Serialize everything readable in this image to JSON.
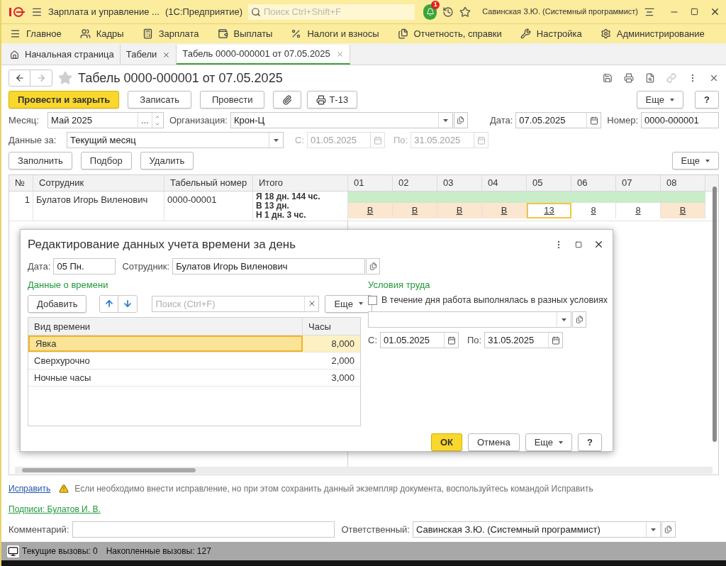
{
  "app": {
    "title": "Зарплата и управление ...",
    "platform": "(1С:Предприятие)",
    "search_placeholder": "Поиск Ctrl+Shift+F",
    "notifications": "1",
    "user": "Савинская З.Ю. (Системный программист)"
  },
  "menu": [
    "Главное",
    "Кадры",
    "Зарплата",
    "Выплаты",
    "Налоги и взносы",
    "Отчетность, справки",
    "Настройка",
    "Администрирование"
  ],
  "tabs": [
    {
      "label": "Начальная страница",
      "kind": "home",
      "selected": false
    },
    {
      "label": "Табели",
      "kind": "closable",
      "selected": false
    },
    {
      "label": "Табель 0000-000001 от 07.05.2025",
      "kind": "closable",
      "selected": true
    }
  ],
  "document": {
    "title": "Табель 0000-000001 от 07.05.2025",
    "actions": [
      {
        "label": "Провести и закрыть",
        "kind": "primary"
      },
      {
        "label": "Записать",
        "kind": "normal"
      },
      {
        "label": "Провести",
        "kind": "normal"
      },
      {
        "kind": "attach"
      },
      {
        "label": "Т-13",
        "kind": "print"
      }
    ],
    "more": "Еще",
    "help": "?",
    "month": {
      "label": "Месяц:",
      "value": "Май 2025",
      "select_button": "..."
    },
    "organization": {
      "label": "Организация:",
      "value": "Крон-Ц"
    },
    "date": {
      "label": "Дата:",
      "value": "07.05.2025"
    },
    "number": {
      "label": "Номер:",
      "value": "0000-000001"
    },
    "period": {
      "label": "Данные за:",
      "value": "Текущий месяц"
    },
    "from": {
      "label": "С:",
      "value": "01.05.2025",
      "disabled": true
    },
    "to": {
      "label": "По:",
      "value": "31.05.2025",
      "disabled": true
    },
    "table_buttons": [
      "Заполнить",
      "Подбор",
      "Удалить"
    ],
    "table_more": "Еще",
    "columns": [
      "№",
      "Сотрудник",
      "Табельный номер",
      "Итого"
    ],
    "days": [
      {
        "day": "01",
        "value": "В",
        "kind": "weekend",
        "selected": false
      },
      {
        "day": "02",
        "value": "В",
        "kind": "weekend",
        "selected": false
      },
      {
        "day": "03",
        "value": "В",
        "kind": "weekend",
        "selected": false
      },
      {
        "day": "04",
        "value": "В",
        "kind": "weekend",
        "selected": false
      },
      {
        "day": "05",
        "value": "13",
        "kind": "workday",
        "selected": true
      },
      {
        "day": "06",
        "value": "8",
        "kind": "workday",
        "selected": false
      },
      {
        "day": "07",
        "value": "8",
        "kind": "workday",
        "selected": false
      },
      {
        "day": "08",
        "value": "В",
        "kind": "weekend",
        "selected": false
      }
    ],
    "rows": [
      {
        "n": "1",
        "employee": "Булатов Игорь Виленович",
        "tab_number": "0000-00001",
        "totals": [
          "Я 18 дн. 144 чс.",
          "В 13 дн.",
          "Н 1 дн. 3 чс."
        ]
      }
    ],
    "fix_link": "Исправить",
    "warning": "Если необходимо внести исправление, но при этом сохранить данный экземпляр документа, воспользуйтесь командой Исправить",
    "signatures": "Подписи: Булатов И. В.",
    "comment": {
      "label": "Комментарий:"
    },
    "responsible": {
      "label": "Ответственный:",
      "value": "Савинская З.Ю. (Системный программист)"
    }
  },
  "dialog": {
    "title": "Редактирование данных учета времени за день",
    "date": {
      "label": "Дата:",
      "value": "05 Пн."
    },
    "employee": {
      "label": "Сотрудник:",
      "value": "Булатов Игорь Виленович"
    },
    "time_section": "Данные о времени",
    "add": "Добавить",
    "search_placeholder": "Поиск (Ctrl+F)",
    "more": "Еще",
    "columns": [
      "Вид времени",
      "Часы"
    ],
    "rows": [
      {
        "type": "Явка",
        "hours": "8,000",
        "selected": true
      },
      {
        "type": "Сверхурочно",
        "hours": "2,000",
        "selected": false
      },
      {
        "type": "Ночные часы",
        "hours": "3,000",
        "selected": false
      }
    ],
    "conditions_section": "Условия труда",
    "different_conditions": {
      "label": "В течение дня работа выполнялась в разных условиях",
      "checked": false
    },
    "from": {
      "label": "С:",
      "value": "01.05.2025"
    },
    "to": {
      "label": "По:",
      "value": "31.05.2025"
    },
    "ok": "ОК",
    "cancel": "Отмена",
    "more2": "Еще",
    "help": "?"
  },
  "status": {
    "current": "Текущие вызовы: 0",
    "accumulated": "Накопленные вызовы: 127"
  }
}
